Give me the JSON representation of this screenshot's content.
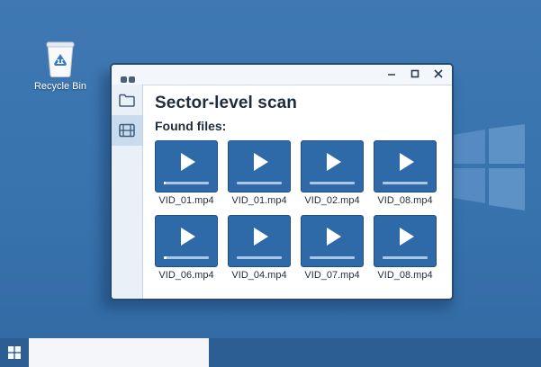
{
  "desktop": {
    "recycle_bin": {
      "label": "Recycle Bin",
      "icon": "recycle-bin-icon"
    },
    "watermark_icon": "windows-logo-icon"
  },
  "window": {
    "title_dots_icon": "window-menu-dots-icon",
    "controls": [
      {
        "name": "minimize",
        "icon": "minimize-icon"
      },
      {
        "name": "maximize",
        "icon": "maximize-icon"
      },
      {
        "name": "close",
        "icon": "close-icon"
      }
    ],
    "sidebar": [
      {
        "name": "folders",
        "icon": "folder-icon",
        "active": false
      },
      {
        "name": "videos",
        "icon": "film-icon",
        "active": true
      }
    ],
    "heading": "Sector-level scan",
    "subheading": "Found files:",
    "files": [
      {
        "name": "VID_01.mp4",
        "progress": 0.04
      },
      {
        "name": "VID_01.mp4",
        "progress": 0
      },
      {
        "name": "VID_02.mp4",
        "progress": 0
      },
      {
        "name": "VID_08.mp4",
        "progress": 0
      },
      {
        "name": "VID_06.mp4",
        "progress": 0.06
      },
      {
        "name": "VID_04.mp4",
        "progress": 0
      },
      {
        "name": "VID_07.mp4",
        "progress": 0
      },
      {
        "name": "VID_08.mp4",
        "progress": 0
      }
    ]
  },
  "taskbar": {
    "start_icon": "windows-start-icon",
    "search_value": ""
  },
  "colors": {
    "desktop_bg": "#3873ad",
    "thumb_bg": "#2f6aa8",
    "window_border": "#27496f",
    "taskbar_bg": "#2c5e94"
  }
}
